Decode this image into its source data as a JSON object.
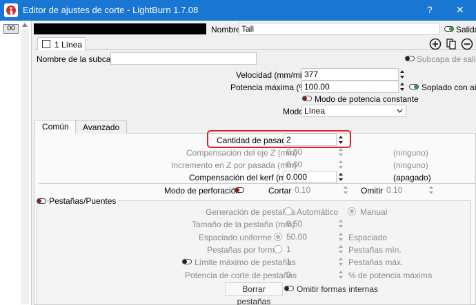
{
  "window": {
    "title": "Editor de ajustes de corte - LightBurn 1.7.08",
    "help": "?",
    "close": "✕"
  },
  "layers": {
    "selected": "00"
  },
  "header": {
    "name_label": "Nombre",
    "name_value": "Tall",
    "output_label": "Salida",
    "color": "#000000"
  },
  "sublayer_tab": {
    "label": "1 Línea"
  },
  "sublayer": {
    "name_label": "Nombre de la subcapa",
    "name_value": "",
    "output_label": "Subcapa de salida"
  },
  "speed": {
    "label": "Velocidad (mm/min)",
    "value": "377"
  },
  "power": {
    "label": "Potencia máxima (%)",
    "value": "100.00"
  },
  "air_assist": {
    "label": "Soplado con aire"
  },
  "constant_power": {
    "label": "Modo de potencia constante"
  },
  "mode": {
    "label": "Modo",
    "value": "Línea"
  },
  "tabs": {
    "common": "Común",
    "advanced": "Avanzado"
  },
  "passes": {
    "label": "Cantidad de pasadas",
    "value": "2"
  },
  "z_offset": {
    "label": "Compensación del eje Z (mm)",
    "value": "0.00",
    "note": "(ninguno)"
  },
  "z_step": {
    "label": "Incremento en Z por pasada (mm)",
    "value": "0.00",
    "note": "(ninguno)"
  },
  "kerf": {
    "label": "Compensación del kerf (mm)",
    "value": "0.000",
    "note": "(apagado)"
  },
  "perforation": {
    "label": "Modo de perforación",
    "cut_label": "Cortar",
    "cut_value": "0.10",
    "skip_label": "Omitir",
    "skip_value": "0.10"
  },
  "tabs_bridges": {
    "title": "Pestañas/Puentes",
    "generation_label": "Generación de pestañas",
    "auto_label": "Automático",
    "manual_label": "Manual",
    "tab_size_label": "Tamaño de la pestaña (mm)",
    "tab_size_value": "0.50",
    "uniform_label": "Espaciado uniforme",
    "uniform_value": "50.00",
    "uniform_unit": "Espaciado",
    "per_shape_label": "Pestañas por forma",
    "per_shape_value": "1",
    "per_shape_unit": "Pestañas mín.",
    "max_label": "Límite máximo de pestañas",
    "max_value": "1",
    "max_unit": "Pestañas máx.",
    "power_label": "Potencia de corte de pestañas",
    "power_value": "0",
    "power_unit": "% de potencia máxima",
    "clear_button": "Borrar pestañas",
    "skip_inner_label": "Omitir formas internas"
  }
}
